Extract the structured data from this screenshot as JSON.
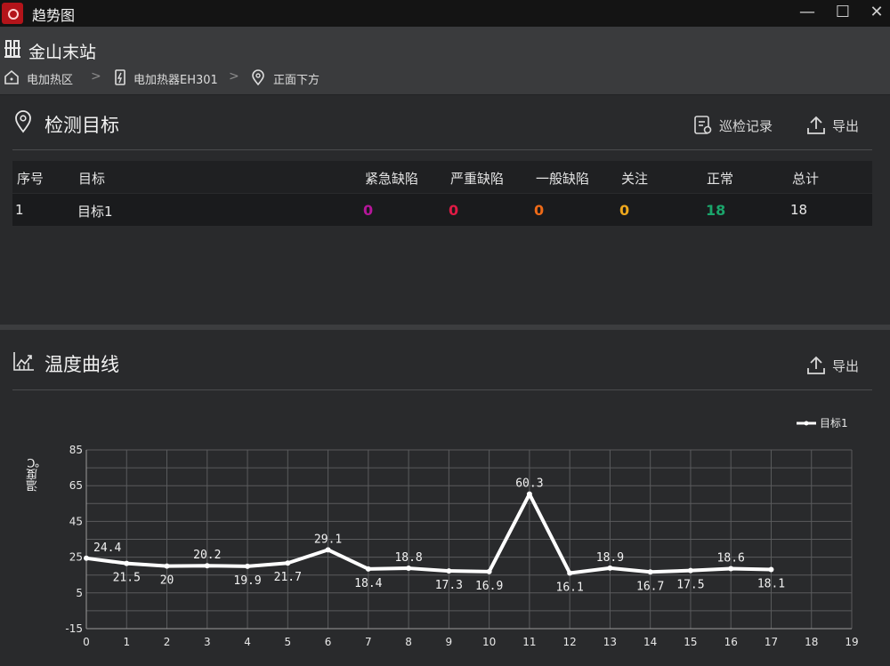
{
  "window": {
    "title": "趋势图",
    "min_glyph": "—",
    "max_glyph": "☐",
    "close_glyph": "✕"
  },
  "header": {
    "station": "金山末站",
    "breadcrumb": [
      {
        "label": "电加热区",
        "icon": "home-icon"
      },
      {
        "label": "电加热器EH301",
        "icon": "device-icon"
      },
      {
        "label": "正面下方",
        "icon": "location-pin-icon"
      }
    ],
    "separator": ">"
  },
  "detect": {
    "title": "检测目标",
    "inspect_label": "巡检记录",
    "export_label": "导出",
    "columns": [
      "序号",
      "目标",
      "紧急缺陷",
      "严重缺陷",
      "一般缺陷",
      "关注",
      "正常",
      "总计"
    ],
    "row": {
      "index": "1",
      "target": "目标1",
      "urgent": "0",
      "serious": "0",
      "general": "0",
      "attention": "0",
      "normal": "18",
      "total": "18"
    },
    "colors": {
      "urgent": "#b5169a",
      "serious": "#e01b45",
      "general": "#ee6a17",
      "attention": "#eda71d",
      "normal": "#1aa56b"
    }
  },
  "temp": {
    "title": "温度曲线",
    "export_label": "导出"
  },
  "chart_data": {
    "type": "line",
    "ylabel": "温度℃",
    "xlabel": "",
    "xlim": [
      0,
      19
    ],
    "ylim": [
      -15,
      85
    ],
    "yticks": [
      85,
      65,
      45,
      25,
      5,
      -15
    ],
    "xticks": [
      0,
      1,
      2,
      3,
      4,
      5,
      6,
      7,
      8,
      9,
      10,
      11,
      12,
      13,
      14,
      15,
      16,
      17,
      18,
      19
    ],
    "grid": true,
    "legend_position": "top-right",
    "series": [
      {
        "name": "目标1",
        "color": "#ffffff",
        "x": [
          0,
          1,
          2,
          3,
          4,
          5,
          6,
          7,
          8,
          9,
          10,
          11,
          12,
          13,
          14,
          15,
          16,
          17
        ],
        "values": [
          24.4,
          21.5,
          20,
          20.2,
          19.9,
          21.7,
          29.1,
          18.4,
          18.8,
          17.3,
          16.9,
          60.3,
          16.1,
          18.9,
          16.7,
          17.5,
          18.6,
          18.1
        ],
        "labels": [
          "24.4",
          "21.5",
          "20",
          "20.2",
          "19.9",
          "21.7",
          "29.1",
          "18.4",
          "18.8",
          "17.3",
          "16.9",
          "60.3",
          "16.1",
          "18.9",
          "16.7",
          "17.5",
          "18.6",
          "18.1"
        ]
      }
    ]
  }
}
